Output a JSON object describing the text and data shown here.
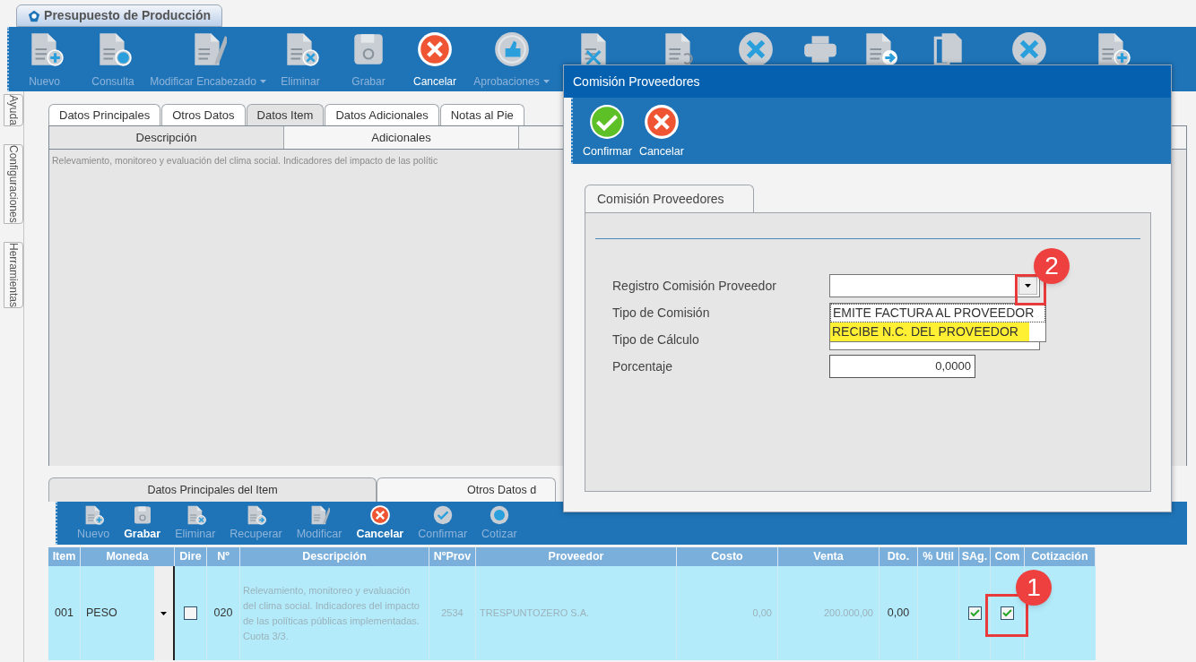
{
  "app_tab": {
    "label": "Presupuesto de Producción"
  },
  "toolbar": [
    {
      "label": "Nuevo",
      "kind": "new",
      "disabled": true,
      "menu": false
    },
    {
      "label": "Consulta",
      "kind": "query",
      "disabled": true,
      "menu": false
    },
    {
      "label": "Modificar Encabezado",
      "kind": "edit",
      "disabled": true,
      "menu": true
    },
    {
      "label": "Eliminar",
      "kind": "delete",
      "disabled": true,
      "menu": false
    },
    {
      "label": "Grabar",
      "kind": "save",
      "disabled": true,
      "menu": false
    },
    {
      "label": "Cancelar",
      "kind": "cancel",
      "disabled": false,
      "menu": false
    },
    {
      "label": "Aprobaciones",
      "kind": "approve",
      "disabled": true,
      "menu": true
    },
    {
      "kind": "doc-cross"
    },
    {
      "kind": "doc-undo"
    },
    {
      "kind": "circle-cross"
    },
    {
      "kind": "print"
    },
    {
      "kind": "doc-send"
    },
    {
      "kind": "copy"
    },
    {
      "kind": "cross"
    },
    {
      "kind": "new"
    }
  ],
  "side_tabs": [
    {
      "label": "Ayuda"
    },
    {
      "label": "Configuraciones"
    },
    {
      "label": "Herramientas"
    }
  ],
  "main_tabs": [
    {
      "label": "Datos Principales",
      "selected": false
    },
    {
      "label": "Otros Datos",
      "selected": false
    },
    {
      "label": "Datos Item",
      "selected": true
    },
    {
      "label": "Datos Adicionales",
      "selected": false
    },
    {
      "label": "Notas al Pie",
      "selected": false
    }
  ],
  "sub_tabs": [
    {
      "label": "Descripción",
      "selected": true
    },
    {
      "label": "Adicionales",
      "selected": false
    }
  ],
  "description_text": "Relevamiento, monitoreo y evaluación del clima social. Indicadores del impacto de las polític",
  "item_tabs": [
    {
      "label": "Datos Principales del Item",
      "selected": true
    },
    {
      "label": "Otros Datos d",
      "selected": false
    }
  ],
  "item_toolbar": [
    {
      "label": "Nuevo",
      "kind": "new",
      "disabled": true
    },
    {
      "label": "Grabar",
      "kind": "save",
      "disabled": false
    },
    {
      "label": "Eliminar",
      "kind": "delete",
      "disabled": true
    },
    {
      "label": "Recuperar",
      "kind": "restore",
      "disabled": true
    },
    {
      "label": "Modificar",
      "kind": "edit",
      "disabled": true
    },
    {
      "label": "Cancelar",
      "kind": "cancel",
      "disabled": false
    },
    {
      "label": "Confirmar",
      "kind": "check",
      "disabled": true
    },
    {
      "label": "Cotizar",
      "kind": "quote",
      "disabled": true
    }
  ],
  "table": {
    "columns": [
      "Item",
      "Moneda",
      "Dire",
      "Nº",
      "Descripción",
      "NºProv",
      "Proveedor",
      "Costo",
      "Venta",
      "Dto.",
      "% Util",
      "SAg.",
      "Com",
      "Cotización"
    ],
    "rows": [
      {
        "item": "001",
        "moneda": "PESO",
        "dire": false,
        "numero": "020",
        "descripcion": "Relevamiento, monitoreo y evaluación del clima social. Indicadores del impacto de las políticas públicas implementadas. Cuota 3/3.",
        "nprov": "2534",
        "proveedor": "TRESPUNTOZERO S.A.",
        "costo": "0,00",
        "venta": "200.000,00",
        "dto": "0,00",
        "sag": true,
        "com": true
      }
    ]
  },
  "dialog": {
    "title": "Comisión Proveedores",
    "toolbar": [
      {
        "label": "Confirmar",
        "kind": "confirm"
      },
      {
        "label": "Cancelar",
        "kind": "cancel"
      }
    ],
    "group_tab": "Comisión Proveedores",
    "fields": [
      {
        "label": "Registro Comisión Proveedor",
        "kind": "combo"
      },
      {
        "label": "Tipo de Comisión",
        "kind": "covered"
      },
      {
        "label": "Tipo de Cálculo",
        "kind": "text"
      },
      {
        "label": "Porcentaje",
        "kind": "number",
        "value": "0,0000"
      }
    ],
    "dropdown_options": [
      {
        "label": "EMITE FACTURA AL PROVEEDOR",
        "selected": false
      },
      {
        "label": "RECIBE N.C. DEL PROVEEDOR",
        "selected": true
      }
    ]
  },
  "annotations": [
    {
      "label": "1"
    },
    {
      "label": "2"
    }
  ]
}
